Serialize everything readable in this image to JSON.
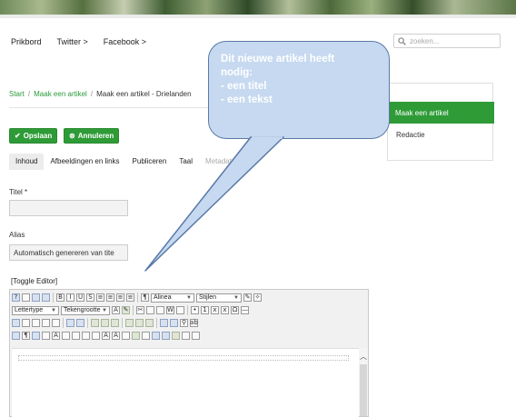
{
  "topnav": [
    "Prikbord",
    "Twitter >",
    "Facebook >"
  ],
  "search": {
    "placeholder": "zoeken..."
  },
  "breadcrumb": {
    "start": "Start",
    "parent": "Maak een artikel",
    "current": "Maak een artikel - Drielanden"
  },
  "toolbar": {
    "save_label": "Opslaan",
    "cancel_label": "Annuleren"
  },
  "tabs": [
    "Inhoud",
    "Afbeeldingen en links",
    "Publiceren",
    "Taal",
    "Metadata"
  ],
  "form": {
    "title_label": "Titel *",
    "title_value": "",
    "alias_label": "Alias",
    "alias_value": "Automatisch genereren van tite"
  },
  "sidebar": {
    "items": [
      "Maak een artikel",
      "Redactie"
    ]
  },
  "editor": {
    "toggle_label": "[Toggle Editor]",
    "format_select": "Alinea",
    "styles_select": "Stijlen",
    "font_select": "Lettertype",
    "size_select": "Tekengrootte"
  },
  "callout": {
    "lines": [
      "Dit nieuwe artikel heeft",
      "nodig:",
      "- een titel",
      "- een tekst"
    ]
  },
  "colors": {
    "accent": "#2e9b37",
    "callout_fill": "#c6d9f0",
    "callout_border": "#5a79a6",
    "link": "#2a9a3a"
  }
}
